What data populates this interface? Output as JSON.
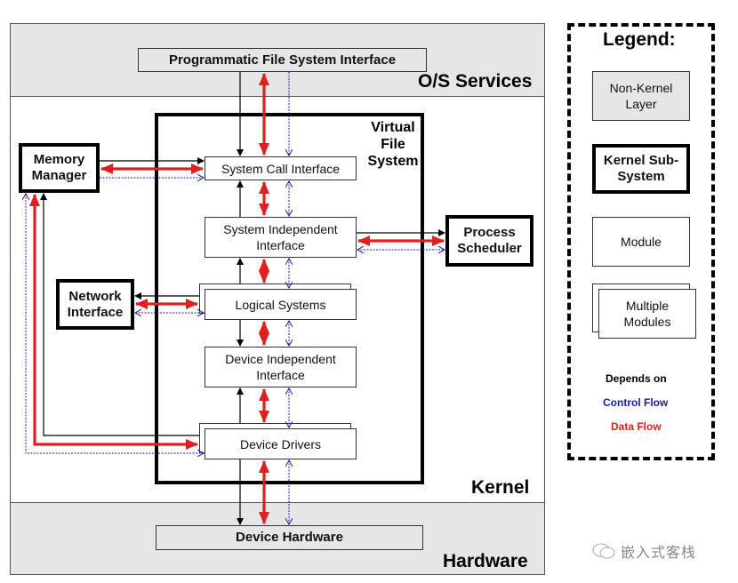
{
  "layers": {
    "os_services": "O/S Services",
    "kernel": "Kernel",
    "hardware": "Hardware"
  },
  "boxes": {
    "programmatic_fs_interface": "Programmatic File System Interface",
    "vfs_title_line1": "Virtual",
    "vfs_title_line2": "File",
    "vfs_title_line3": "System",
    "system_call_interface": "System Call Interface",
    "system_independent_interface_line1": "System Independent",
    "system_independent_interface_line2": "Interface",
    "logical_systems": "Logical Systems",
    "device_independent_interface_line1": "Device Independent",
    "device_independent_interface_line2": "Interface",
    "device_drivers": "Device Drivers",
    "device_hardware": "Device Hardware",
    "memory_manager_line1": "Memory",
    "memory_manager_line2": "Manager",
    "network_interface_line1": "Network",
    "network_interface_line2": "Interface",
    "process_scheduler_line1": "Process",
    "process_scheduler_line2": "Scheduler"
  },
  "legend": {
    "title": "Legend:",
    "non_kernel_line1": "Non-Kernel",
    "non_kernel_line2": "Layer",
    "kernel_sub_line1": "Kernel Sub-",
    "kernel_sub_line2": "System",
    "module": "Module",
    "multiple_line1": "Multiple",
    "multiple_line2": "Modules",
    "depends_on": "Depends on",
    "control_flow": "Control Flow",
    "data_flow": "Data Flow"
  },
  "colors": {
    "data_flow": "#e02020",
    "control_flow": "#1a1aa6",
    "depends_on": "#000000",
    "layer_gray": "#e6e6e6"
  },
  "watermark": "嵌入式客栈"
}
